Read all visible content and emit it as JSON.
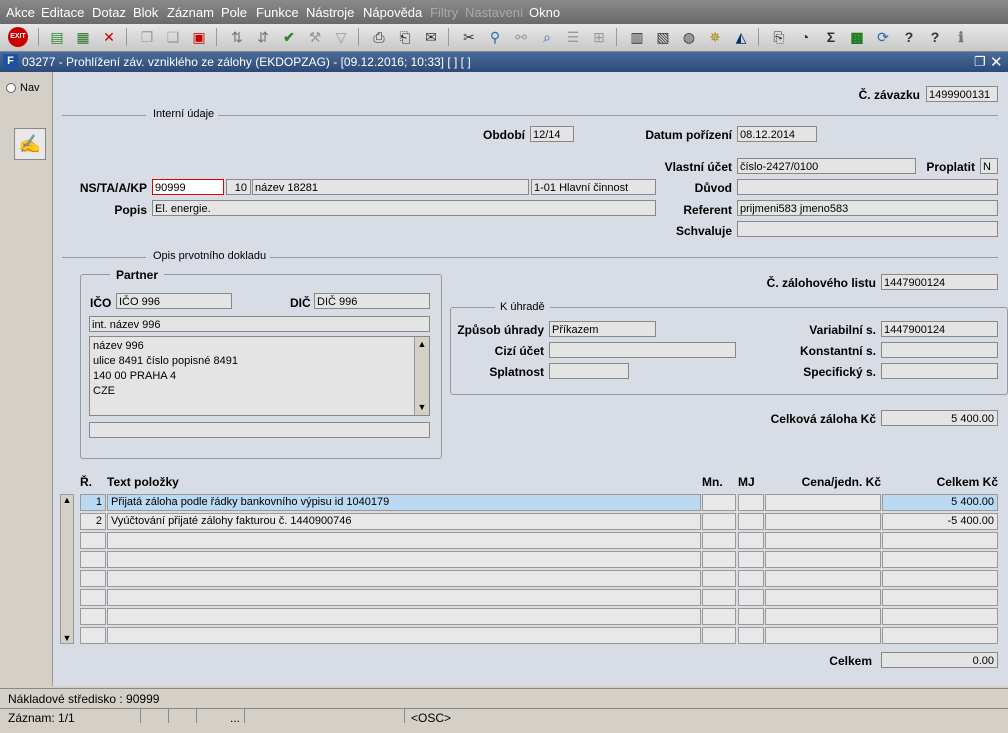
{
  "menu": [
    "Akce",
    "Editace",
    "Dotaz",
    "Blok",
    "Záznam",
    "Pole",
    "Funkce",
    "Nástroje",
    "Nápověda",
    "Filtry",
    "Nastavení",
    "Okno"
  ],
  "window_title": "03277 - Prohlížení záv. vzniklého ze zálohy (EKDOPZAG) - [09.12.2016; 10:33]  [ ]  [ ]",
  "nav_label": "Nav",
  "header": {
    "zavazek_label": "Č. závazku",
    "zavazek_value": "1499900131",
    "interni_udaje": "Interní údaje",
    "obdobi_label": "Období",
    "obdobi_value": "12/14",
    "datum_label": "Datum pořízení",
    "datum_value": "08.12.2014",
    "vlastni_ucet_label": "Vlastní účet",
    "vlastni_ucet_value": "číslo-2427/0100",
    "proplatit_label": "Proplatit",
    "proplatit_value": "N",
    "ns_label": "NS/TA/A/KP",
    "ns_value": "90999",
    "ta_value": "10",
    "nazev_value": "název 18281",
    "kp_value": "1-01 Hlavní činnost",
    "duvod_label": "Důvod",
    "duvod_value": "",
    "popis_label": "Popis",
    "popis_value": "El. energie.",
    "referent_label": "Referent",
    "referent_value": "prijmeni583 jmeno583",
    "schvaluje_label": "Schvaluje",
    "schvaluje_value": ""
  },
  "opis": {
    "title": "Opis prvotního dokladu",
    "partner_title": "Partner",
    "ico_label": "IČO",
    "ico_value": "IČO 996",
    "dic_label": "DIČ",
    "dic_value": "DIČ 996",
    "int_nazev": "int. název 996",
    "address": [
      "název 996",
      "ulice 8491 číslo popisné 8491",
      "140 00 PRAHA 4",
      "CZE"
    ],
    "zalohovy_label": "Č. zálohového listu",
    "zalohovy_value": "1447900124",
    "k_uhrade_title": "K úhradě",
    "zpusob_label": "Způsob úhrady",
    "zpusob_value": "Příkazem",
    "cizi_label": "Cizí účet",
    "cizi_value": "",
    "splatnost_label": "Splatnost",
    "splatnost_value": "",
    "variabilni_label": "Variabilní s.",
    "variabilni_value": "1447900124",
    "konstantni_label": "Konstantní s.",
    "konstantni_value": "",
    "specificky_label": "Specifický s.",
    "specificky_value": "",
    "celkova_label": "Celková záloha Kč",
    "celkova_value": "5 400.00"
  },
  "table": {
    "headers": {
      "r": "Ř.",
      "text": "Text položky",
      "mn": "Mn.",
      "mj": "MJ",
      "cena": "Cena/jedn. Kč",
      "celkem": "Celkem Kč"
    },
    "rows": [
      {
        "r": "1",
        "text": "Přijatá záloha podle řádky bankovního výpisu id 1040179",
        "mn": "",
        "mj": "",
        "cena": "",
        "celkem": "5 400.00"
      },
      {
        "r": "2",
        "text": "Vyúčtování přijaté zálohy fakturou č. 1440900746",
        "mn": "",
        "mj": "",
        "cena": "",
        "celkem": "-5 400.00"
      }
    ],
    "total_label": "Celkem",
    "total_value": "0.00"
  },
  "status": {
    "line1": "Nákladové středisko : 90999",
    "zaznam": "Záznam: 1/1",
    "dots": "...",
    "osc": "<OSC>"
  }
}
